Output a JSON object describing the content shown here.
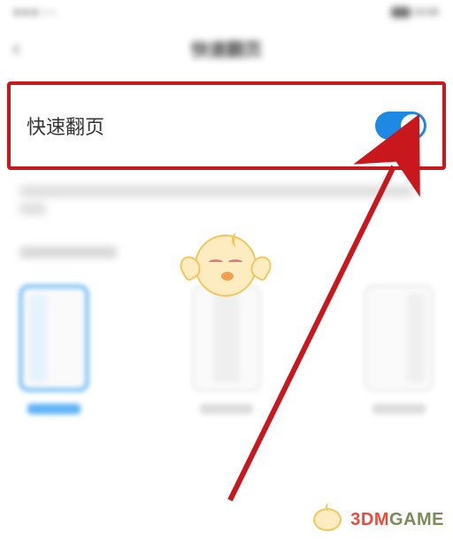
{
  "status": {
    "time": "10:00"
  },
  "header": {
    "title": "快速翻页"
  },
  "setting": {
    "label": "快速翻页",
    "enabled": true
  },
  "options": {
    "items": [
      {
        "selected": true
      },
      {
        "selected": false
      },
      {
        "selected": false
      }
    ]
  },
  "watermark": {
    "text_prefix": "3DM",
    "text_suffix": "GAME"
  },
  "annotation": {
    "color": "#c9171e"
  }
}
